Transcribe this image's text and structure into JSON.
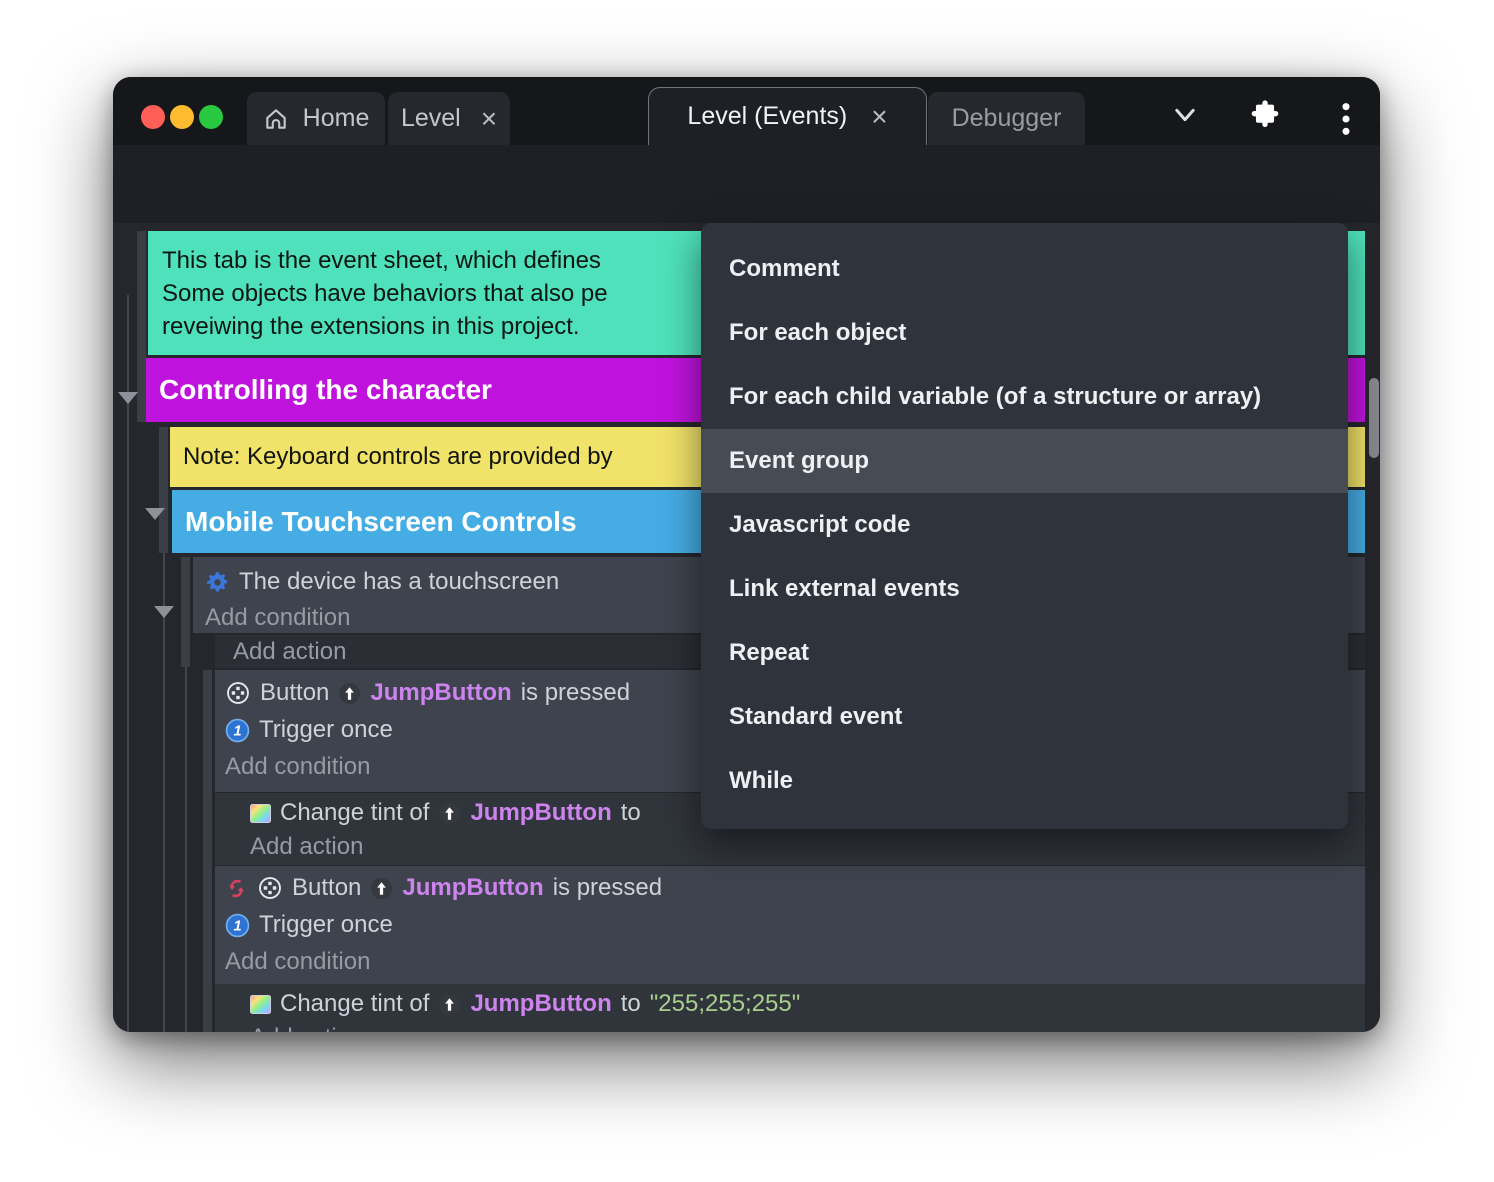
{
  "window": {
    "tabs": {
      "home": "Home",
      "level": "Level",
      "level_events": "Level (Events)",
      "debugger": "Debugger",
      "close_glyph": "×"
    }
  },
  "menu": {
    "items": [
      {
        "label": "Comment"
      },
      {
        "label": "For each object"
      },
      {
        "label": "For each child variable (of a structure or array)"
      },
      {
        "label": "Event group"
      },
      {
        "label": "Javascript code"
      },
      {
        "label": "Link external events"
      },
      {
        "label": "Repeat"
      },
      {
        "label": "Standard event"
      },
      {
        "label": "While"
      }
    ],
    "highlighted": "Event group"
  },
  "sheet": {
    "comment_intro": {
      "line1": "This tab is the event sheet, which defines",
      "line2": "Some objects have behaviors that also pe",
      "line3": "reveiwing the extensions in this project."
    },
    "group_controlling": "Controlling the character",
    "note_keyboard": "Note: Keyboard controls are provided by",
    "group_mobile": "Mobile Touchscreen Controls",
    "rows": {
      "device_condition": "The device has a touchscreen",
      "add_condition": "Add condition",
      "add_action": "Add action",
      "button": "Button",
      "jump_button": "JumpButton",
      "is_pressed": "is pressed",
      "trigger_once": "Trigger once",
      "change_tint": "Change tint of",
      "to": "to",
      "tint_value": "\"255;255;255\"",
      "trigger_badge": "1"
    }
  },
  "colors": {
    "accent_purple": "#5b2ee1",
    "comment_teal": "#4fe1bb",
    "group_magenta": "#bf13dd",
    "note_yellow": "#f1e269",
    "group_blue": "#45ace4",
    "menu_highlight": "#464b54",
    "object_text": "#cd84ee",
    "string_green": "#a9cf8e"
  }
}
